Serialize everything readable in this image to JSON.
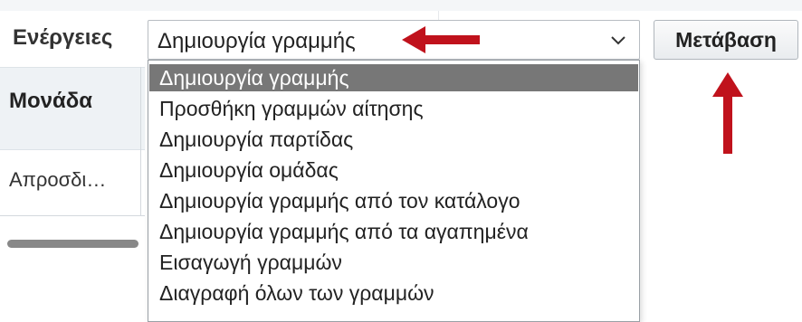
{
  "toolbar": {
    "actions_label": "Ενέργειες",
    "select_value": "Δημιουργία γραμμής",
    "go_label": "Μετάβαση"
  },
  "table": {
    "column_header": "Μονάδα",
    "cell_value": "Απροσδι…"
  },
  "dropdown": {
    "selected_index": 0,
    "options": [
      "Δημιουργία γραμμής",
      "Προσθήκη γραμμών αίτησης",
      "Δημιουργία παρτίδας",
      "Δημιουργία ομάδας",
      "Δημιουργία γραμμής από τον κατάλογο",
      "Δημιουργία γραμμής από τα αγαπημένα",
      "Εισαγωγή γραμμών",
      "Διαγραφή όλων των γραμμών"
    ]
  },
  "icons": {
    "chevron": "chevron-down-icon",
    "arrow_left": "arrow-left-icon",
    "arrow_up": "arrow-up-icon"
  },
  "colors": {
    "selected_option_bg": "#777777",
    "annotation_red": "#c0121c"
  }
}
